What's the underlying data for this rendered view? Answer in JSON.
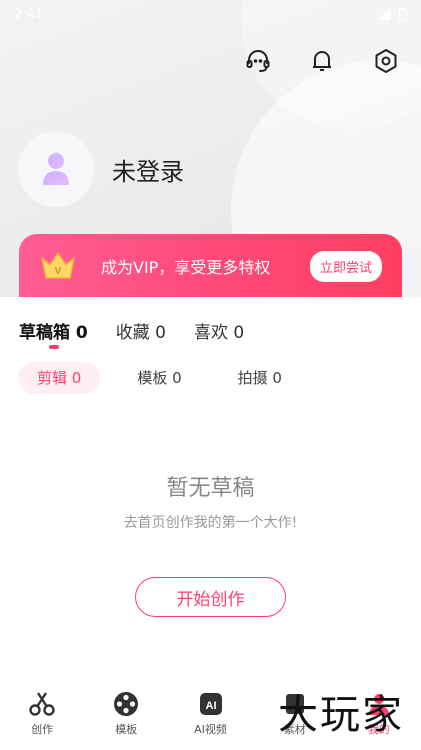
{
  "status_bar": {
    "time": "2:41"
  },
  "header": {
    "icons": [
      "headset-icon",
      "bell-icon",
      "settings-icon"
    ]
  },
  "profile": {
    "login_text": "未登录"
  },
  "vip_banner": {
    "text": "成为VIP，享受更多特权",
    "button": "立即尝试"
  },
  "tabs": [
    {
      "label": "草稿箱 0",
      "active": true
    },
    {
      "label": "收藏 0",
      "active": false
    },
    {
      "label": "喜欢 0",
      "active": false
    }
  ],
  "subtabs": [
    {
      "label": "剪辑 0",
      "active": true
    },
    {
      "label": "模板 0",
      "active": false
    },
    {
      "label": "拍摄 0",
      "active": false
    }
  ],
  "empty_state": {
    "title": "暂无草稿",
    "subtitle": "去首页创作我的第一个大作!",
    "button": "开始创作"
  },
  "bottom_nav": [
    {
      "label": "创作",
      "icon": "scissors-icon"
    },
    {
      "label": "模板",
      "icon": "film-reel-icon"
    },
    {
      "label": "AI视频",
      "icon": "ai-icon"
    },
    {
      "label": "素材",
      "icon": "material-icon"
    },
    {
      "label": "我的",
      "icon": "profile-icon",
      "active": true
    }
  ],
  "watermark": "大玩家",
  "colors": {
    "accent": "#ff3e6e",
    "vip_gradient_start": "#ff5d94",
    "vip_gradient_end": "#ff3e61"
  }
}
